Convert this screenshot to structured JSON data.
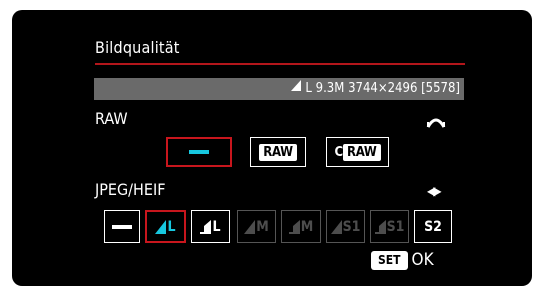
{
  "title": "Bildqualität",
  "info_bar": {
    "size_icon": "fine-large-icon",
    "size_label": "L",
    "megapixels": "9.3M",
    "resolution": "3744×2496",
    "shots_remaining": "[5578]"
  },
  "raw_section": {
    "label": "RAW",
    "control_hint_icon": "main-dial-icon",
    "options": [
      {
        "id": "none",
        "label": "",
        "icon": "dash-icon",
        "selected": true
      },
      {
        "id": "raw",
        "label": "RAW",
        "icon": "raw-icon",
        "selected": false
      },
      {
        "id": "craw",
        "label_prefix": "C",
        "label": "RAW",
        "icon": "craw-icon",
        "selected": false
      }
    ]
  },
  "jpeg_section": {
    "label": "JPEG/HEIF",
    "control_hint_icon": "left-right-arrows-icon",
    "options": [
      {
        "id": "none",
        "label": "",
        "icon": "dash-icon",
        "selected": false,
        "enabled": true
      },
      {
        "id": "fine-l",
        "label": "L",
        "icon": "fine-quality-icon",
        "selected": true,
        "enabled": true
      },
      {
        "id": "normal-l",
        "label": "L",
        "icon": "normal-quality-icon",
        "selected": false,
        "enabled": true
      },
      {
        "id": "fine-m",
        "label": "M",
        "icon": "fine-quality-icon",
        "selected": false,
        "enabled": false
      },
      {
        "id": "normal-m",
        "label": "M",
        "icon": "normal-quality-icon",
        "selected": false,
        "enabled": false
      },
      {
        "id": "fine-s1",
        "label": "S1",
        "icon": "fine-quality-icon",
        "selected": false,
        "enabled": false
      },
      {
        "id": "normal-s1",
        "label": "S1",
        "icon": "normal-quality-icon",
        "selected": false,
        "enabled": false
      },
      {
        "id": "s2",
        "label": "S2",
        "icon": "",
        "selected": false,
        "enabled": true
      }
    ]
  },
  "footer": {
    "set_label": "SET",
    "ok_label": "OK"
  },
  "colors": {
    "background": "#000000",
    "accent_red": "#c8161d",
    "selection_cyan": "#17c7df",
    "info_bar": "#6a6a6a",
    "disabled": "#4d4d4d"
  }
}
